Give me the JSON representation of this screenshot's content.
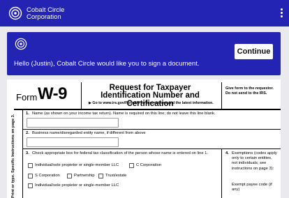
{
  "header": {
    "brand_line1": "Cobalt Circle",
    "brand_line2": "Corporation",
    "menu_icon": "kebab-menu-icon"
  },
  "banner": {
    "message": "Hello (Justin), Cobalt Circle would like you to sign a document.",
    "continue_label": "Continue"
  },
  "document": {
    "form_word": "Form",
    "form_code": "W-9",
    "title_line1": "Request for Taxpayer",
    "title_line2": "Identification Number and Certification",
    "goto_text": "▶ Go to www.irs.gov/FormW9 for instructions and the latest information.",
    "give_form": "Give form to the requestor. Do not send to the IRS.",
    "line1_num": "1.",
    "line1_label": "Name (as shown on your income tax return). Name is required on this line; do not leave this line blank.",
    "line2_num": "2.",
    "line2_label": "Business name/disregarded entity name, if different from above",
    "line3_num": "3.",
    "line3_label": "Check appropriate box for federal tax classification of the person whose name is entered on line 1.",
    "line3_options": [
      "Individual/sole propietor or single-member LLC",
      "C Corporation",
      "S Corporation",
      "Partnership",
      "Trust/estate",
      "Individual/sole propietor or single-member LLC"
    ],
    "line4_num": "4.",
    "exemptions_text": "Exemptions (codes apply only to certain entities, not individuals; see instructions on page 3):",
    "exempt_payee": "Exempt payee code (if any)",
    "side_text_1": "Print or type.",
    "side_text_2": "Specific Instructions on page 3."
  }
}
